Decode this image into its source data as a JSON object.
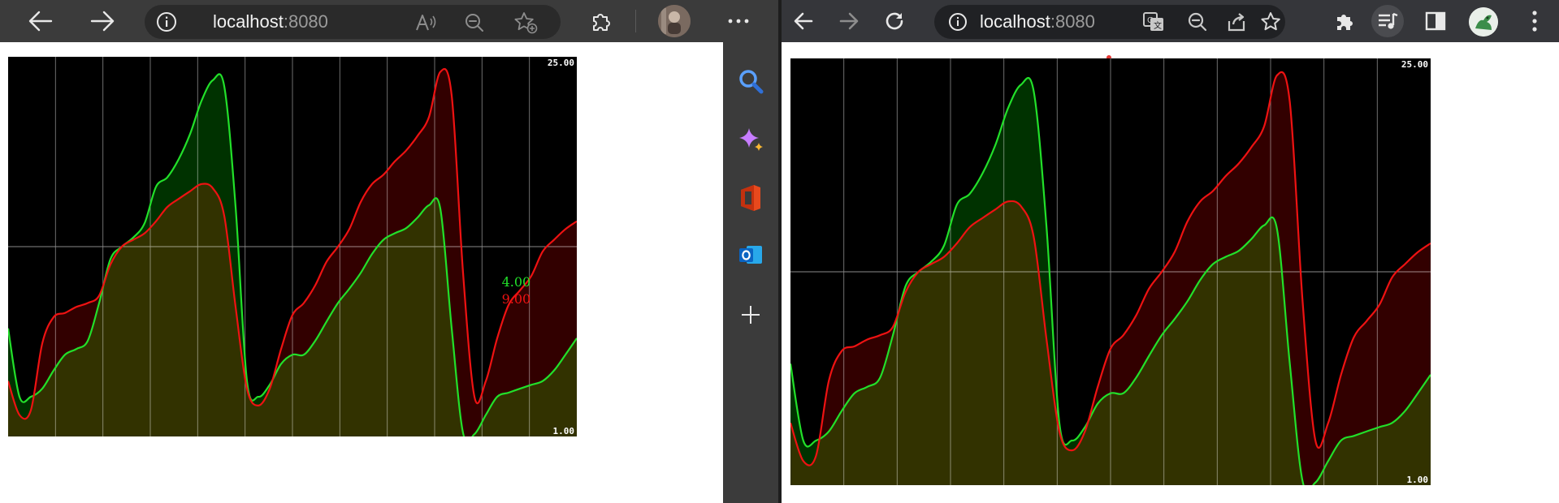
{
  "edge": {
    "url_host": "localhost",
    "url_port": ":8080",
    "icons": {
      "back": "back-arrow-icon",
      "forward": "forward-arrow-icon",
      "site_info": "info-icon",
      "read_aloud": "read-aloud-icon",
      "zoom": "zoom-out-icon",
      "favorite": "add-favorite-icon",
      "extensions": "extensions-icon",
      "profile": "profile-avatar",
      "menu": "more-menu-icon"
    },
    "sidebar": [
      {
        "name": "search",
        "icon": "search-icon",
        "color": "#4f8cff"
      },
      {
        "name": "copilot",
        "icon": "sparkle-icon",
        "color": "#c77dff"
      },
      {
        "name": "office",
        "icon": "office-icon",
        "color": "#eb3c00"
      },
      {
        "name": "outlook",
        "icon": "outlook-icon",
        "color": "#0a78d4"
      },
      {
        "name": "add",
        "icon": "plus-icon",
        "color": "#e8e8e8"
      }
    ]
  },
  "chrome": {
    "url_host": "localhost",
    "url_port": ":8080",
    "icons": {
      "back": "back-arrow-icon",
      "forward": "forward-arrow-icon",
      "reload": "reload-icon",
      "site_info": "info-icon",
      "translate": "translate-icon",
      "zoom": "zoom-out-icon",
      "share": "share-icon",
      "bookmark": "star-icon",
      "extensions": "puzzle-icon",
      "media": "media-control-icon",
      "side_panel": "side-panel-icon",
      "profile": "profile-avatar",
      "menu": "kebab-menu-icon"
    }
  },
  "chart_data": [
    {
      "type": "area",
      "label_top": "25.00",
      "label_bottom": "1.00",
      "ylim": [
        1,
        25
      ],
      "ylog": true,
      "x": [
        0,
        2,
        4,
        6,
        8,
        10,
        12,
        14,
        16,
        18,
        20,
        22,
        24,
        26,
        28,
        30,
        32,
        34,
        36,
        38,
        40,
        42,
        44,
        46,
        48,
        50,
        52,
        54,
        56,
        58,
        60,
        62,
        64,
        66,
        68,
        70,
        72,
        74,
        76,
        78,
        80,
        82,
        84,
        86,
        88,
        90,
        92,
        94,
        96,
        98,
        100
      ],
      "series": [
        {
          "name": "",
          "color": "#22e02a",
          "fill": "#003200",
          "values": [
            2.5,
            1.4,
            1.4,
            1.5,
            1.75,
            2.0,
            2.1,
            2.25,
            3.1,
            4.5,
            5.0,
            5.4,
            6.1,
            8.3,
            9.0,
            10.5,
            13.0,
            17.2,
            20.5,
            19.5,
            7.0,
            1.6,
            1.4,
            1.55,
            1.85,
            2.0,
            2.0,
            2.25,
            2.65,
            3.1,
            3.5,
            4.0,
            4.7,
            5.3,
            5.6,
            5.85,
            6.4,
            7.1,
            6.9,
            2.5,
            1.03,
            1.02,
            1.2,
            1.4,
            1.45,
            1.5,
            1.55,
            1.6,
            1.75,
            2.0,
            2.3
          ]
        },
        {
          "name": "",
          "color": "#ee1212",
          "fill": "#320000",
          "values": [
            1.6,
            1.2,
            1.25,
            2.2,
            2.75,
            2.85,
            3.0,
            3.1,
            3.3,
            4.3,
            5.0,
            5.3,
            5.6,
            6.2,
            7.0,
            7.5,
            8.0,
            8.5,
            8.2,
            6.5,
            3.0,
            1.5,
            1.3,
            1.5,
            2.1,
            2.8,
            3.1,
            3.6,
            4.4,
            5.0,
            5.8,
            7.3,
            8.5,
            9.2,
            10.3,
            11.3,
            12.8,
            15.0,
            22.0,
            18.0,
            4.0,
            1.4,
            1.6,
            2.3,
            3.05,
            3.45,
            3.9,
            4.8,
            5.3,
            5.8,
            6.2
          ]
        }
      ],
      "annotations": [
        {
          "text": "4.00",
          "color": "#22e02a"
        },
        {
          "text": "9.00",
          "color": "#ee1212"
        }
      ]
    },
    {
      "type": "area",
      "label_top": "25.00",
      "label_bottom": "1.00",
      "ylim": [
        1,
        25
      ],
      "ylog": true,
      "x": [
        0,
        2,
        4,
        6,
        8,
        10,
        12,
        14,
        16,
        18,
        20,
        22,
        24,
        26,
        28,
        30,
        32,
        34,
        36,
        38,
        40,
        42,
        44,
        46,
        48,
        50,
        52,
        54,
        56,
        58,
        60,
        62,
        64,
        66,
        68,
        70,
        72,
        74,
        76,
        78,
        80,
        82,
        84,
        86,
        88,
        90,
        92,
        94,
        96,
        98,
        100
      ],
      "series": [
        {
          "name": "",
          "color": "#22e02a",
          "fill": "#003200",
          "values": [
            2.5,
            1.4,
            1.4,
            1.5,
            1.75,
            2.0,
            2.1,
            2.25,
            3.1,
            4.5,
            5.0,
            5.4,
            6.1,
            8.3,
            9.0,
            10.5,
            13.0,
            17.2,
            20.5,
            19.5,
            7.0,
            1.6,
            1.4,
            1.55,
            1.85,
            2.0,
            2.0,
            2.25,
            2.65,
            3.1,
            3.5,
            4.0,
            4.7,
            5.3,
            5.6,
            5.85,
            6.4,
            7.1,
            6.9,
            2.5,
            1.03,
            1.02,
            1.2,
            1.4,
            1.45,
            1.5,
            1.55,
            1.6,
            1.75,
            2.0,
            2.3
          ]
        },
        {
          "name": "",
          "color": "#ee1212",
          "fill": "#320000",
          "values": [
            1.6,
            1.2,
            1.25,
            2.2,
            2.75,
            2.85,
            3.0,
            3.1,
            3.3,
            4.3,
            5.0,
            5.3,
            5.6,
            6.2,
            7.0,
            7.5,
            8.0,
            8.5,
            8.2,
            6.5,
            3.0,
            1.5,
            1.3,
            1.5,
            2.1,
            2.8,
            3.1,
            3.6,
            4.4,
            5.0,
            5.8,
            7.3,
            8.5,
            9.2,
            10.3,
            11.3,
            12.8,
            15.0,
            22.0,
            18.0,
            4.0,
            1.4,
            1.6,
            2.3,
            3.05,
            3.45,
            3.9,
            4.8,
            5.3,
            5.8,
            6.2
          ]
        }
      ],
      "annotations": []
    }
  ]
}
